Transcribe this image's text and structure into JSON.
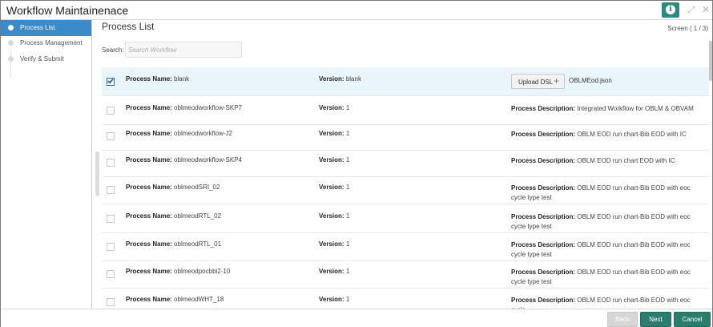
{
  "window": {
    "title": "Workflow Maintainenace"
  },
  "sidebar": {
    "steps": [
      {
        "label": "Process List",
        "active": true
      },
      {
        "label": "Process Management",
        "active": false
      },
      {
        "label": "Verify & Submit",
        "active": false
      }
    ]
  },
  "main": {
    "title": "Process List",
    "screen_indicator": "Screen ( 1 / 3)",
    "search_label": "Search:",
    "search_placeholder": "Search Workflow",
    "labels": {
      "process_name": "Process Name:",
      "version": "Version:",
      "process_description": "Process Description:"
    },
    "upload_label": "Upload DSL",
    "uploaded_file": "OBLMEod.json",
    "rows": [
      {
        "name": "blank",
        "version": "blank",
        "selected": true,
        "description": ""
      },
      {
        "name": "oblmeodworkflow-SKP7",
        "version": "1",
        "selected": false,
        "description": "Integrated Workflow for OBLM & OBVAM"
      },
      {
        "name": "oblmeodworkflow-J2",
        "version": "1",
        "selected": false,
        "description": "OBLM EOD run chart-Bib EOD with IC"
      },
      {
        "name": "oblmeodworkflow-SKP4",
        "version": "1",
        "selected": false,
        "description": "OBLM EOD run chart EOD with IC"
      },
      {
        "name": "oblmeodSRI_02",
        "version": "1",
        "selected": false,
        "description": "OBLM EOD run chart-Bib EOD with eoc cycle type test"
      },
      {
        "name": "oblmeodRTL_02",
        "version": "1",
        "selected": false,
        "description": "OBLM EOD run chart-Bib EOD with eoc cycle type test"
      },
      {
        "name": "oblmeodRTL_01",
        "version": "1",
        "selected": false,
        "description": "OBLM EOD run chart-Bib EOD with eoc cycle type test"
      },
      {
        "name": "oblmeodpocbbi2-10",
        "version": "1",
        "selected": false,
        "description": "OBLM EOD run chart-Bib EOD with eoc cycle type test"
      },
      {
        "name": "oblmeodWHT_18",
        "version": "1",
        "selected": false,
        "description": "OBLM EOD run chart-Bib EOD with eoc cycle"
      }
    ]
  },
  "footer": {
    "back_label": "Back",
    "next_label": "Next",
    "cancel_label": "Cancel"
  },
  "icons": {
    "info": "info-icon",
    "restore": "restore-icon",
    "close": "close-icon",
    "plus": "plus-icon"
  },
  "colors": {
    "accent_blue": "#3d8ac8",
    "teal": "#2b7d6e",
    "selected_row": "#eaf4fb"
  }
}
